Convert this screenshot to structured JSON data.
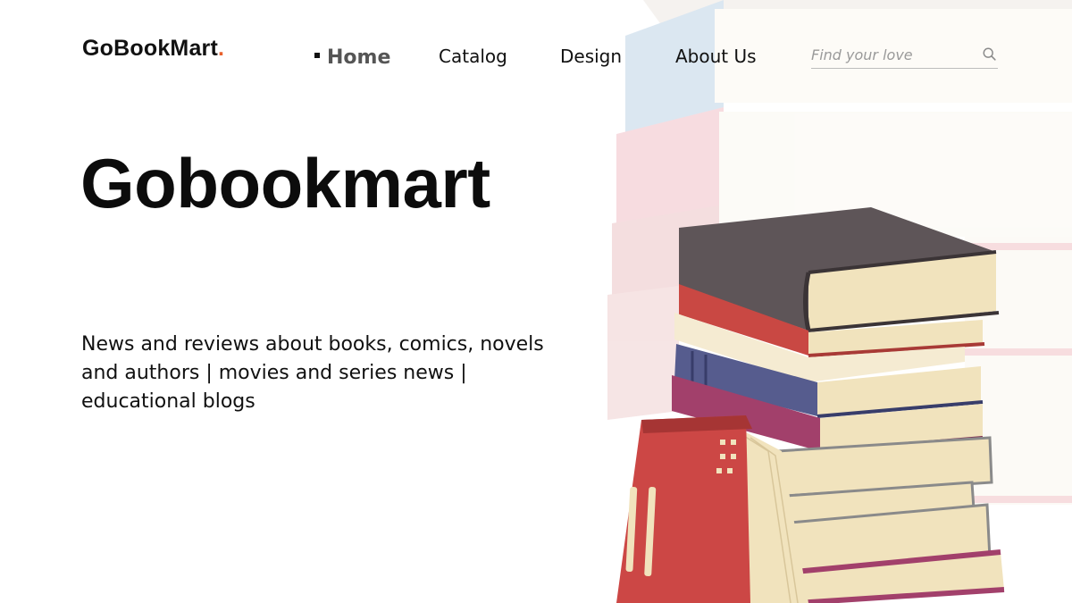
{
  "brand": {
    "name": "GoBookMart",
    "dot": ".",
    "accent_color": "#e8602c"
  },
  "nav": {
    "items": [
      {
        "label": "Home",
        "active": true
      },
      {
        "label": "Catalog",
        "active": false
      },
      {
        "label": "Design",
        "active": false
      },
      {
        "label": "About Us",
        "active": false
      }
    ]
  },
  "search": {
    "placeholder": "Find your love",
    "value": "",
    "icon": "search-icon"
  },
  "hero": {
    "title": "Gobookmart",
    "description": "News and reviews about books, comics, novels and authors | movies and series news | educational blogs"
  },
  "illustration": {
    "name": "book-stack-illustration"
  }
}
